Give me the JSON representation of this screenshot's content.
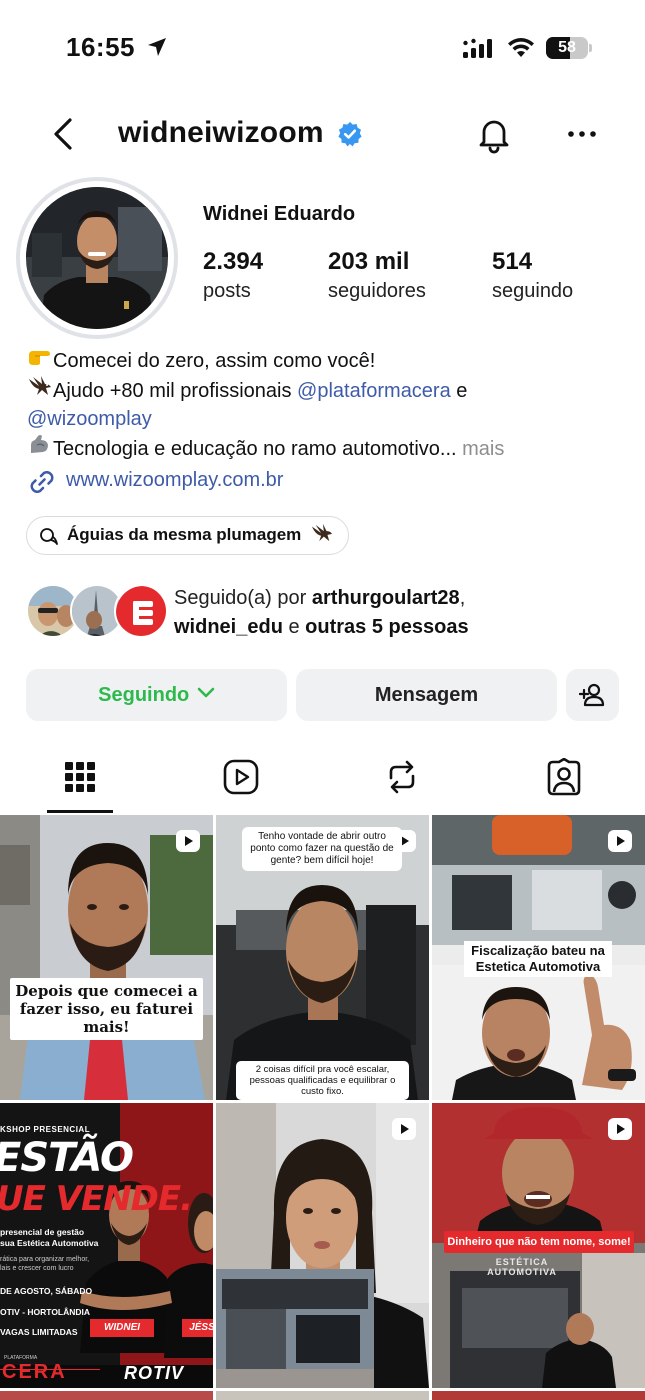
{
  "status_bar": {
    "time": "16:55",
    "battery": "58",
    "battery_level": 0.58
  },
  "header": {
    "username": "widneiwizoom"
  },
  "profile": {
    "full_name": "Widnei Eduardo",
    "stats": [
      {
        "value": "2.394",
        "label": "posts"
      },
      {
        "value": "203 mil",
        "label": "seguidores"
      },
      {
        "value": "514",
        "label": "seguindo"
      }
    ],
    "bio": {
      "line1": "Comecei do zero, assim como você!",
      "line2_prefix": "Ajudo +80 mil profissionais ",
      "line2_mention": "@plataformacera",
      "line2_suffix": " e",
      "line3_mention": "@wizoomplay",
      "line4": "Tecnologia e educação no ramo automotivo...",
      "more": " mais"
    },
    "link": "www.wizoomplay.com.br",
    "highlight_chip": "Águias da mesma plumagem"
  },
  "followed_by": {
    "prefix": "Seguido(a) por ",
    "user1": "arthurgoulart28",
    "comma": ",",
    "user2": "widnei_edu",
    "middle": " e ",
    "others": "outras 5 pessoas"
  },
  "actions": {
    "following": "Seguindo",
    "message": "Mensagem"
  },
  "tabs": [
    {
      "name": "grid",
      "icon": "grid-icon",
      "selected": true
    },
    {
      "name": "reels",
      "icon": "reels-icon",
      "selected": false
    },
    {
      "name": "reposts",
      "icon": "repost-icon",
      "selected": false
    },
    {
      "name": "tagged",
      "icon": "tagged-icon",
      "selected": false
    }
  ],
  "posts": {
    "p1_caption": "Depois que comecei a fazer isso, eu faturei mais!",
    "p2_top": "Tenho vontade de abrir outro ponto como fazer na questão de gente? bem difícil hoje!",
    "p2_bottom": "2 coisas difícil pra você escalar, pessoas qualificadas e equilibrar o custo fixo.",
    "p3_caption": "Fiscalização bateu na Estetica Automotiva",
    "p4_top": "KSHOP PRESENCIAL",
    "p4_title1": "ESTÃO",
    "p4_title2": "UE VENDE.",
    "p4_desc1": "presencial de gestão",
    "p4_desc2": "sua Estética Automotiva",
    "p4_desc3": "rática para organizar melhor,",
    "p4_desc4": "lais e crescer com lucro",
    "p4_date": "DE AGOSTO, SÁBADO",
    "p4_place": "OTIV - HORTOLÂNDIA",
    "p4_spots": "VAGAS LIMITADAS",
    "p4_name1": "WIDNEI",
    "p4_name2": "JÉSS",
    "p4_platform": "PLATAFORMA",
    "p4_brand1": "CERA",
    "p4_brand2": "ROTIV",
    "p6_caption": "Dinheiro que não tem nome, some!",
    "p6_sign": "ESTÉTICA AUTOMOTIVA"
  },
  "colors": {
    "accent_blue": "#3e5ba9",
    "following_green": "#2eb94d",
    "verified_blue": "#3897f0",
    "brand_red": "#e52a2d"
  }
}
